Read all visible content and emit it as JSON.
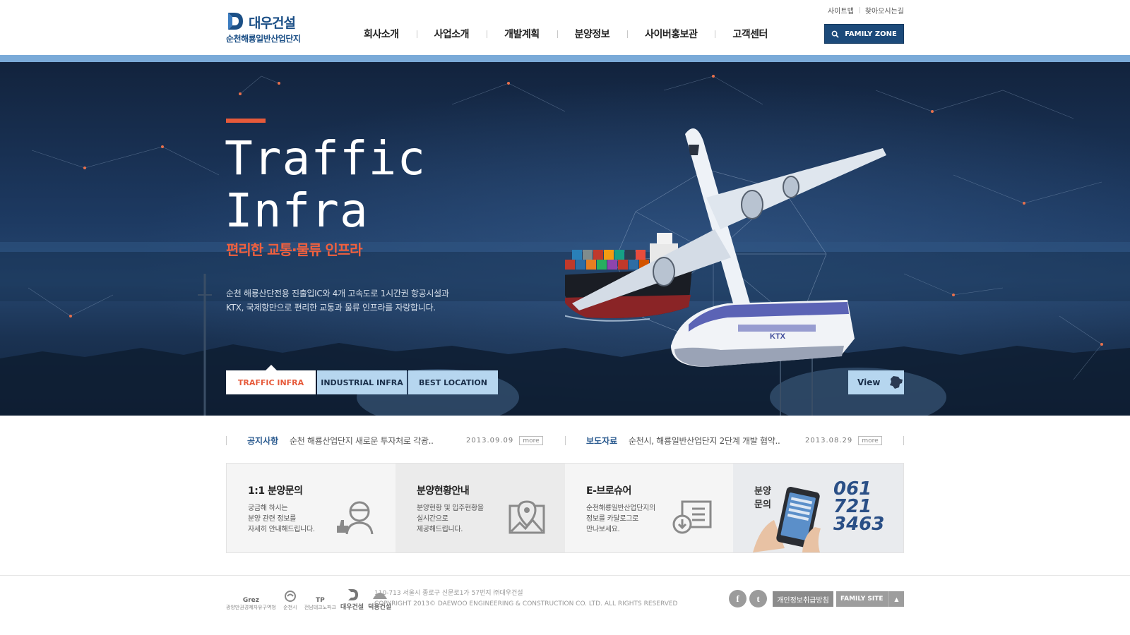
{
  "header": {
    "brand": "대우건설",
    "sub_brand": "순천해룡일반산업단지",
    "nav": [
      "회사소개",
      "사업소개",
      "개발계획",
      "분양정보",
      "사이버홍보관",
      "고객센터"
    ],
    "util_links": [
      "사이트맵",
      "찾아오시는길"
    ],
    "family_zone": "FAMILY ZONE",
    "accent_color": "#7aaad8",
    "brand_color": "#1b4f86"
  },
  "hero": {
    "title_line1": "Traffic",
    "title_line2": "Infra",
    "subtitle": "편리한 교통·물류 인프라",
    "desc_line1": "순천 해룡산단전용 진출입IC와 4개 고속도로 1시간권 항공시설과",
    "desc_line2": "KTX, 국제항만으로 편리한 교통과 물류 인프라를 자랑합니다.",
    "tabs": [
      "TRAFFIC INFRA",
      "INDUSTRIAL INFRA",
      "BEST LOCATION"
    ],
    "active_tab": "TRAFFIC INFRA",
    "view_label": "View",
    "accent_color": "#e65a3a",
    "train_label": "KTX"
  },
  "news": {
    "notice": {
      "label": "공지사항",
      "title": "순천 해룡산업단지 새로운 투자처로 각광..",
      "date": "2013.09.09",
      "more": "more"
    },
    "press": {
      "label": "보도자료",
      "title": "순천시, 해룡일반산업단지 2단계 개발 협약..",
      "date": "2013.08.29",
      "more": "more"
    }
  },
  "quick": {
    "inquiry": {
      "title": "1:1 분양문의",
      "lines": [
        "궁금해 하시는",
        "분양 관련 정보를",
        "자세히 안내해드립니다."
      ],
      "icon": "counselor-icon"
    },
    "status": {
      "title": "분양현황안내",
      "lines": [
        "분양현황 및 입주현황을",
        "실시간으로",
        "제공해드립니다."
      ],
      "icon": "map-pin-icon"
    },
    "brochure": {
      "title": "E-브로슈어",
      "lines": [
        "순천해룡일반산업단지의",
        "정보를 카달로그로",
        "만나보세요."
      ],
      "icon": "brochure-icon"
    },
    "call": {
      "label_line1": "분양",
      "label_line2": "문의",
      "phone_line1": "061",
      "phone_line2": "721",
      "phone_line3": "3463"
    }
  },
  "footer": {
    "logos": [
      {
        "name": "Grez",
        "caption": "광양만권경제자유구역청"
      },
      {
        "name": "",
        "caption": "순천시"
      },
      {
        "name": "TP",
        "caption": "전남테크노파크"
      },
      {
        "name": "대우건설",
        "caption": ""
      },
      {
        "name": "덕용건설",
        "caption": ""
      }
    ],
    "address": "110-713 서울시 종로구 신문로1가 57번지 ㈜대우건설",
    "copyright": "COPYRIGHT 2013© DAEWOO ENGINEERING & CONSTRUCTION CO. LTD. ALL RIGHTS RESERVED",
    "privacy": "개인정보취급방침",
    "family_site": "FAMILY SITE",
    "family_arrow": "▲",
    "sns": [
      "facebook-icon",
      "twitter-icon"
    ],
    "facebook_glyph": "f",
    "twitter_glyph": "t"
  }
}
